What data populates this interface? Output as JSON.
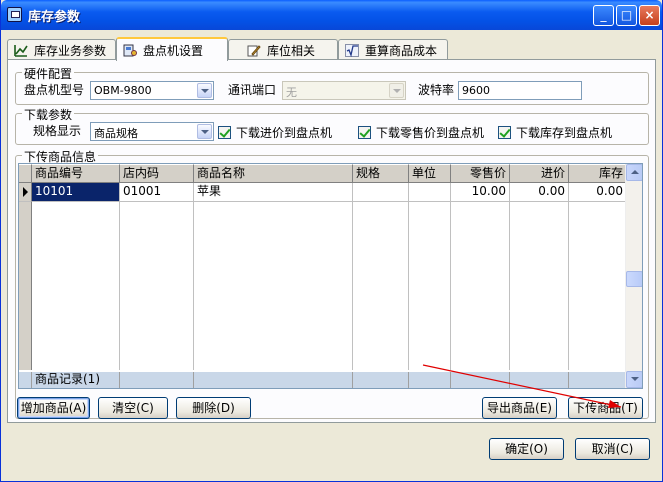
{
  "window": {
    "title": "库存参数",
    "controls": {
      "minimize": "_",
      "maximize": "□",
      "close": "×"
    }
  },
  "tabs": [
    {
      "label": "库存业务参数",
      "icon": "chart-icon",
      "active": false
    },
    {
      "label": "盘点机设置",
      "icon": "device-icon",
      "active": true
    },
    {
      "label": "库位相关",
      "icon": "pencil-icon",
      "active": false
    },
    {
      "label": "重算商品成本",
      "icon": "sqrt-icon",
      "active": false
    }
  ],
  "hardware": {
    "title": "硬件配置",
    "device_model_label": "盘点机型号",
    "device_model_value": "OBM-9800",
    "port_label": "通讯端口",
    "port_value": "无",
    "baud_label": "波特率",
    "baud_value": "9600"
  },
  "download": {
    "title": "下载参数",
    "spec_label": "规格显示",
    "spec_value": "商品规格",
    "options": [
      {
        "label": "下载进价到盘点机",
        "checked": true
      },
      {
        "label": "下载零售价到盘点机",
        "checked": true
      },
      {
        "label": "下载库存到盘点机",
        "checked": true
      }
    ]
  },
  "upload": {
    "title": "下传商品信息",
    "columns": [
      "商品编号",
      "店内码",
      "商品名称",
      "规格",
      "单位",
      "零售价",
      "进价",
      "库存"
    ],
    "rows": [
      {
        "code": "10101",
        "store_code": "01001",
        "name": "苹果",
        "spec": "",
        "unit": "",
        "retail": "10.00",
        "cost": "0.00",
        "stock": "0.00"
      }
    ],
    "footer": "商品记录(1)"
  },
  "buttons": {
    "add": "增加商品(A)",
    "clear": "清空(C)",
    "delete": "删除(D)",
    "export": "导出商品(E)",
    "download": "下传商品(T)",
    "ok": "确定(O)",
    "cancel": "取消(C)"
  },
  "colors": {
    "title_bar": "#0a5bf0",
    "selection": "#0a246a",
    "annotation_arrow": "#e00000"
  }
}
